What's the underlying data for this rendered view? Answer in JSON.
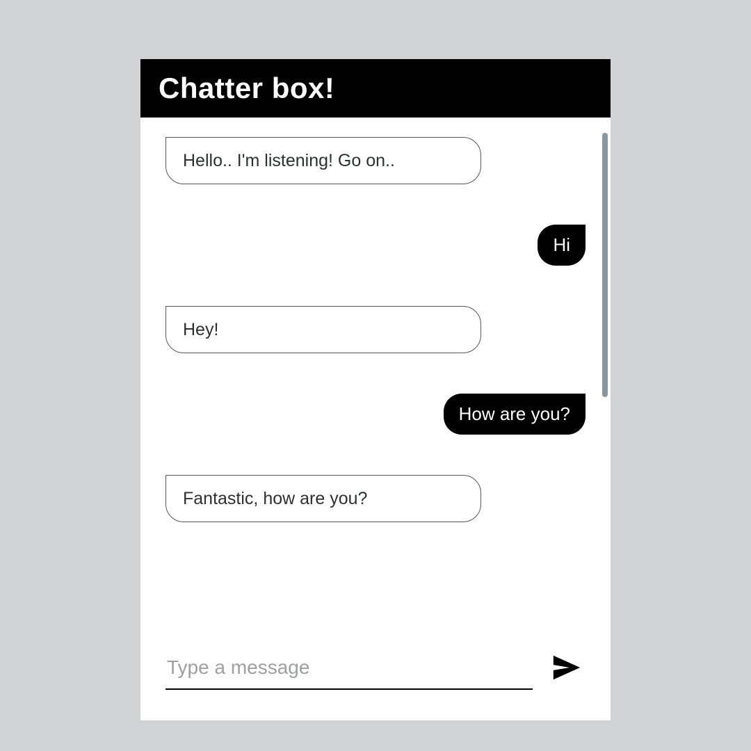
{
  "header": {
    "title": "Chatter box!"
  },
  "messages": [
    {
      "sender": "bot",
      "text": "Hello.. I'm listening! Go on.."
    },
    {
      "sender": "user",
      "text": "Hi"
    },
    {
      "sender": "bot",
      "text": "Hey!"
    },
    {
      "sender": "user",
      "text": "How are you?"
    },
    {
      "sender": "bot",
      "text": "Fantastic, how are you?"
    }
  ],
  "input": {
    "placeholder": "Type a message",
    "value": ""
  },
  "icons": {
    "send": "send-icon"
  }
}
